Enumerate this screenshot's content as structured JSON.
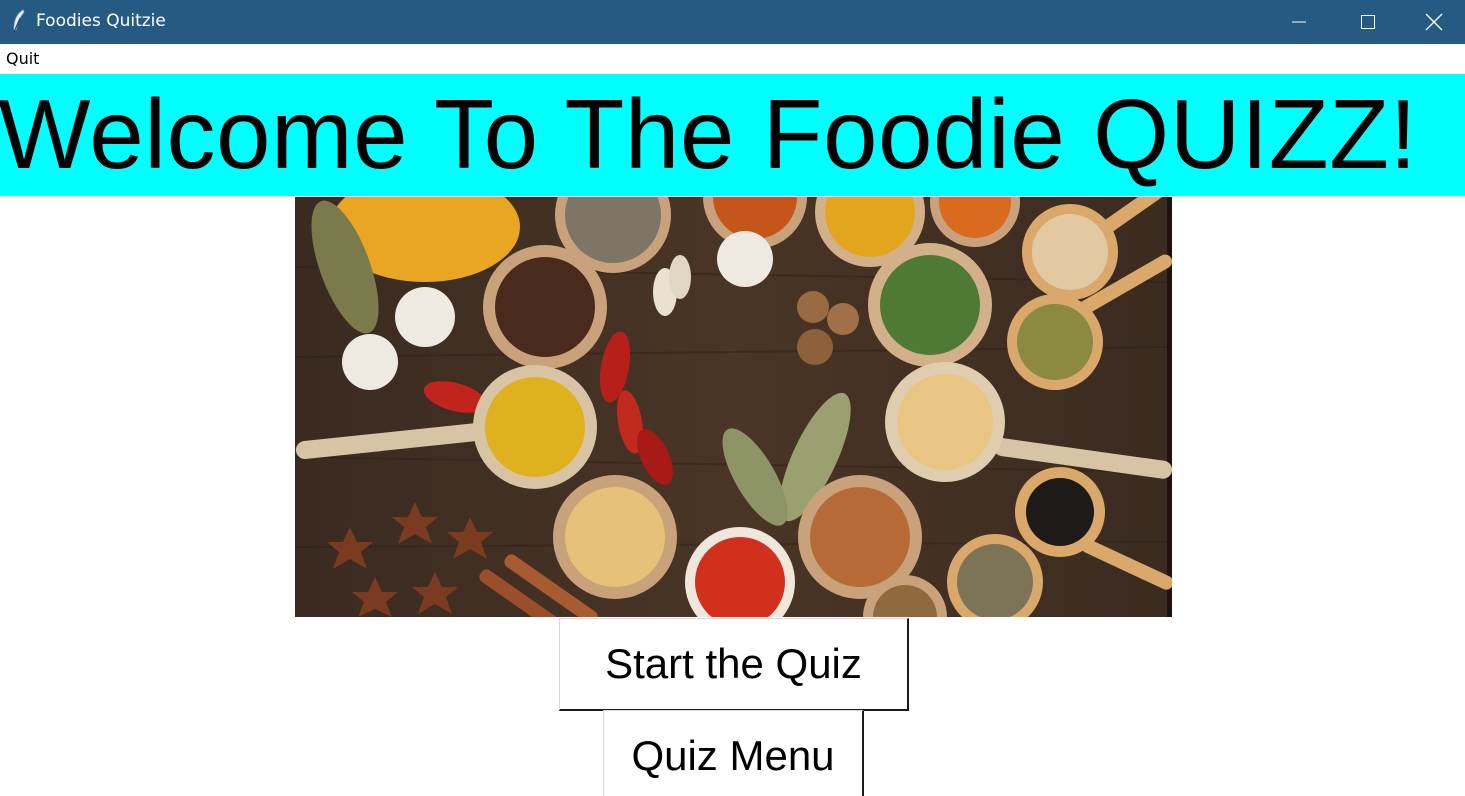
{
  "window": {
    "title": "Foodies Quitzie",
    "icon": "feather-icon",
    "controls": [
      "minimize-icon",
      "maximize-icon",
      "close-icon"
    ]
  },
  "menubar": {
    "quit_label": "Quit"
  },
  "banner": {
    "text": "Welcome To The Foodie QUIZZ!",
    "background": "#00ffff"
  },
  "image": {
    "subject": "spices-photo"
  },
  "buttons": {
    "start_label": "Start the Quiz",
    "menu_label": "Quiz Menu"
  },
  "colors": {
    "titlebar": "#255a82",
    "banner": "#00ffff"
  }
}
